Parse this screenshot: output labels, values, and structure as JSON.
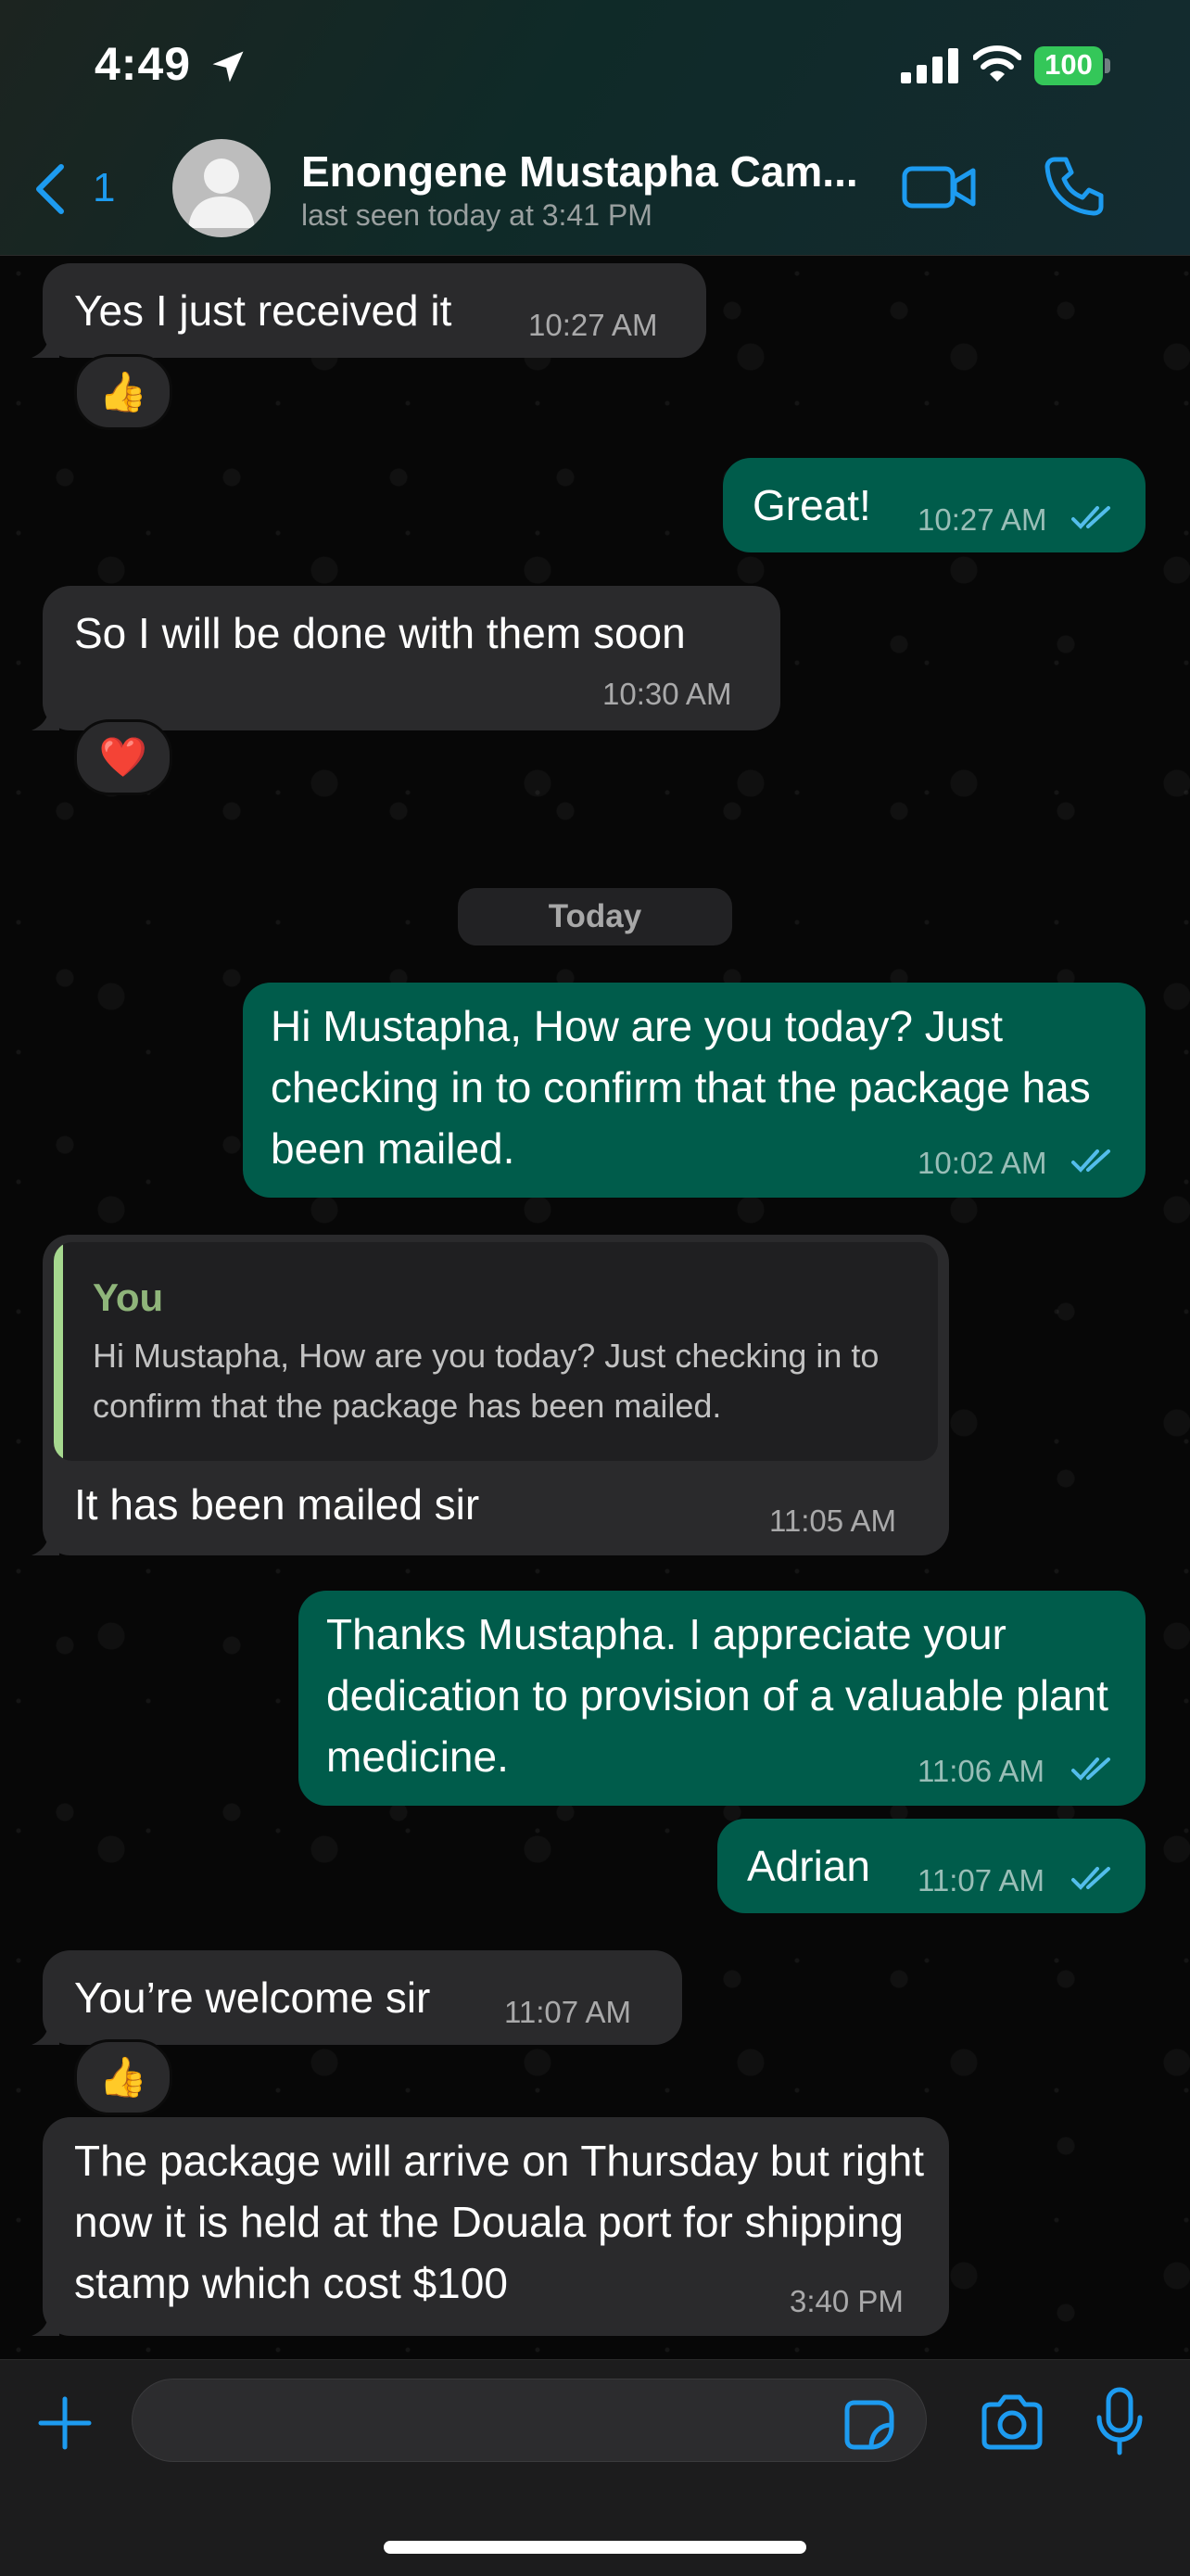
{
  "status_bar": {
    "time": "4:49",
    "battery": "100"
  },
  "header": {
    "back_count": "1",
    "contact_name": "Enongene Mustapha Cam...",
    "last_seen": "last seen today at 3:41 PM"
  },
  "messages": [
    {
      "direction": "incoming",
      "text": "Yes I just received it",
      "time": "10:27 AM",
      "reaction": "👍"
    },
    {
      "direction": "outgoing",
      "text": "Great!",
      "time": "10:27 AM",
      "read": true
    },
    {
      "direction": "incoming",
      "text": "So I will be done with them soon",
      "time": "10:30 AM",
      "reaction": "❤️"
    },
    {
      "direction": "outgoing",
      "text": "Hi Mustapha,  How are you today?  Just checking in to confirm that the package has been mailed.",
      "time": "10:02 AM",
      "read": true
    },
    {
      "direction": "incoming",
      "quote": {
        "author": "You",
        "text": "Hi Mustapha,  How are you today?  Just checking in to confirm that the package has been mailed."
      },
      "text": "It has been mailed sir",
      "time": "11:05 AM"
    },
    {
      "direction": "outgoing",
      "text": "Thanks Mustapha.  I appreciate your dedication to provision of a valuable plant medicine.",
      "time": "11:06 AM",
      "read": true
    },
    {
      "direction": "outgoing",
      "text": "Adrian",
      "time": "11:07 AM",
      "read": true
    },
    {
      "direction": "incoming",
      "text": "You’re welcome sir",
      "time": "11:07 AM",
      "reaction": "👍"
    },
    {
      "direction": "incoming",
      "text": "The package will arrive on Thursday but right now it is held at the Douala port for shipping stamp which cost $100",
      "time": "3:40 PM"
    }
  ],
  "date_divider": "Today",
  "input": {
    "value": ""
  },
  "colors": {
    "accent": "#1d9bf0",
    "incoming_bubble": "#2a2a2c",
    "outgoing_bubble": "#005c4b",
    "read_ticks": "#53bdeb",
    "battery": "#34c759"
  },
  "icons": [
    "location-arrow-icon",
    "signal-icon",
    "wifi-icon",
    "battery-icon",
    "back-chevron-icon",
    "video-call-icon",
    "phone-call-icon",
    "read-receipt-icon",
    "plus-icon",
    "sticker-icon",
    "camera-icon",
    "microphone-icon"
  ]
}
